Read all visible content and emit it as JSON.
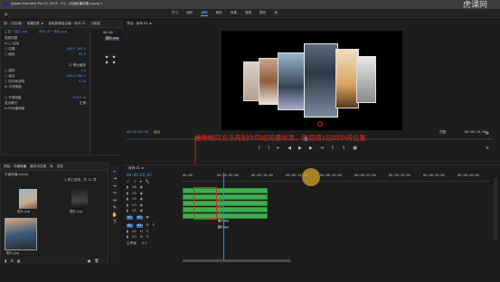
{
  "window": {
    "title": "Adobe Premiere Pro CC 2019 - E:\\...\\平面轮播效果.prproj *",
    "watermark": "虎课网"
  },
  "menu": {
    "items": [
      "学习",
      "组件",
      "编辑",
      "颜色",
      "效果",
      "音频",
      "图形",
      "库"
    ],
    "active_index": 2
  },
  "effects_panel": {
    "tabs": [
      "源：(无剪辑)",
      "效果控件 ≡",
      "音频剪辑混合器：序列 01",
      "元数据"
    ],
    "breadcrumb": "主要 * 图片.jpg",
    "sequence": "序列 01 * 图片.jpg",
    "section_video": "视频效果",
    "rows": [
      {
        "label": "fx □ 运动",
        "value": ""
      },
      {
        "label": "○ 位置",
        "value": "360.0   288.0"
      },
      {
        "label": "○ 缩放",
        "value": "60.0"
      },
      {
        "label": "",
        "value": ""
      },
      {
        "label": "",
        "value": "☑ 等比缩放"
      },
      {
        "label": "○ 旋转",
        "value": "0.0"
      },
      {
        "label": "○ 锚点",
        "value": "360.0   288.0"
      },
      {
        "label": "○ 防闪烁滤镜",
        "value": "0.00"
      },
      {
        "label": "fx 不透明度",
        "value": ""
      },
      {
        "label": "",
        "value": ""
      },
      {
        "label": "○ 不透明度",
        "value": "100.0 %"
      },
      {
        "label": "混合模式",
        "value": "正常"
      },
      {
        "label": "fx 时间重映射",
        "value": ""
      }
    ],
    "mini_timecode": "00:00",
    "mini_clip": "图片.jpg"
  },
  "project_panel": {
    "tabs": [
      "项目：平面轮播",
      "媒体浏览器",
      "库",
      "信息"
    ],
    "file": "平面轮播.prproj",
    "count": "1 项已选择，共 11 项",
    "items": [
      "图片.jpg",
      "图片.jpg",
      "图片.jpg"
    ]
  },
  "program_monitor": {
    "tab": "节目：序列 01 ≡",
    "timecode_left": "00:00:05:00",
    "fit": "适合",
    "quality": "完整",
    "timecode_right": "00:00:25:04"
  },
  "annotation": "使用相同方法再制作四组轮播效果，使视频1回到中间位置",
  "timeline": {
    "tab": "序列 01 ≡",
    "timecode": "00:00:05:02",
    "ruler": [
      "00:00",
      "00:00:05:00",
      "00:00:10:00",
      "00:00:15:00",
      "00:00:20:00",
      "00:00:25:00",
      "00:00:30:00",
      "00:00:35:00",
      "00:00:40:00"
    ],
    "video_tracks": [
      "V6",
      "V5",
      "V4",
      "V3",
      "V2",
      "V1"
    ],
    "audio_tracks": [
      "A1",
      "A2",
      "A3"
    ],
    "master": "主声道",
    "master_value": "0.0",
    "clip_label": "图片.jpg"
  },
  "colors": {
    "accent": "#2d8ceb",
    "clip_green": "#3fae4e",
    "annotation_red": "#e0281e",
    "highlight_box": "#e0281e"
  }
}
